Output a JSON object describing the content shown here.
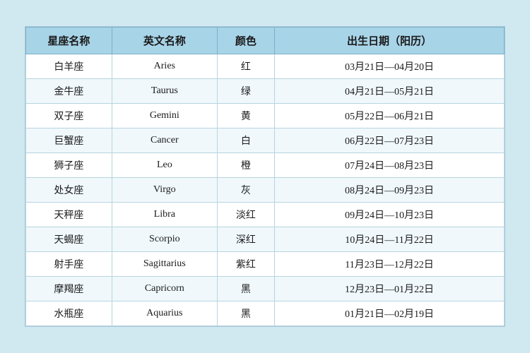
{
  "table": {
    "headers": [
      "星座名称",
      "英文名称",
      "颜色",
      "出生日期（阳历）"
    ],
    "rows": [
      {
        "name": "白羊座",
        "english": "Aries",
        "color": "红",
        "date": "03月21日—04月20日"
      },
      {
        "name": "金牛座",
        "english": "Taurus",
        "color": "绿",
        "date": "04月21日—05月21日"
      },
      {
        "name": "双子座",
        "english": "Gemini",
        "color": "黄",
        "date": "05月22日—06月21日"
      },
      {
        "name": "巨蟹座",
        "english": "Cancer",
        "color": "白",
        "date": "06月22日—07月23日"
      },
      {
        "name": "狮子座",
        "english": "Leo",
        "color": "橙",
        "date": "07月24日—08月23日"
      },
      {
        "name": "处女座",
        "english": "Virgo",
        "color": "灰",
        "date": "08月24日—09月23日"
      },
      {
        "name": "天秤座",
        "english": "Libra",
        "color": "淡红",
        "date": "09月24日—10月23日"
      },
      {
        "name": "天蝎座",
        "english": "Scorpio",
        "color": "深红",
        "date": "10月24日—11月22日"
      },
      {
        "name": "射手座",
        "english": "Sagittarius",
        "color": "紫红",
        "date": "11月23日—12月22日"
      },
      {
        "name": "摩羯座",
        "english": "Capricorn",
        "color": "黑",
        "date": "12月23日—01月22日"
      },
      {
        "name": "水瓶座",
        "english": "Aquarius",
        "color": "黑",
        "date": "01月21日—02月19日"
      }
    ]
  }
}
